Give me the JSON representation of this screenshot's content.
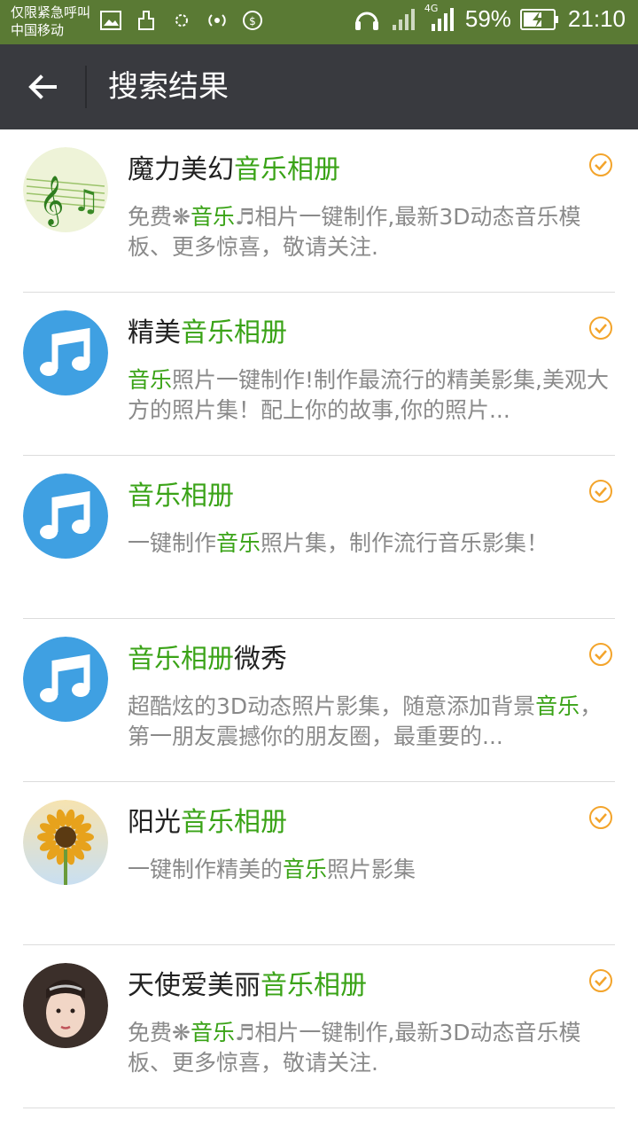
{
  "status_bar": {
    "carrier_line1": "仅限紧急呼叫",
    "carrier_line2": "中国移动",
    "network": "4G",
    "battery": "59%",
    "time": "21:10"
  },
  "toolbar": {
    "title": "搜索结果"
  },
  "results": [
    {
      "avatar": "music-staff-avatar",
      "name_parts": [
        {
          "t": "魔力美幻",
          "h": false
        },
        {
          "t": "音乐相册",
          "h": true
        }
      ],
      "desc_parts": [
        {
          "t": "免费❋",
          "h": false
        },
        {
          "t": "音乐",
          "h": true
        },
        {
          "t": "♬相片一键制作,最新3D动态音乐模板、更多惊喜，敬请关注.",
          "h": false
        }
      ]
    },
    {
      "avatar": "music-note-avatar",
      "name_parts": [
        {
          "t": "精美",
          "h": false
        },
        {
          "t": "音乐相册",
          "h": true
        }
      ],
      "desc_parts": [
        {
          "t": "音乐",
          "h": true
        },
        {
          "t": "照片一键制作!制作最流行的精美影集,美观大方的照片集！配上你的故事,你的照片...",
          "h": false
        }
      ]
    },
    {
      "avatar": "music-note-avatar",
      "name_parts": [
        {
          "t": "音乐相册",
          "h": true
        }
      ],
      "desc_parts": [
        {
          "t": "一键制作",
          "h": false
        },
        {
          "t": "音乐",
          "h": true
        },
        {
          "t": "照片集，制作流行音乐影集！",
          "h": false
        }
      ]
    },
    {
      "avatar": "music-note-avatar",
      "name_parts": [
        {
          "t": "音乐相册",
          "h": true
        },
        {
          "t": "微秀",
          "h": false
        }
      ],
      "desc_parts": [
        {
          "t": "超酷炫的3D动态照片影集，随意添加背景",
          "h": false
        },
        {
          "t": "音乐",
          "h": true
        },
        {
          "t": "，第一朋友震撼你的朋友圈，最重要的...",
          "h": false
        }
      ]
    },
    {
      "avatar": "sunflower-avatar",
      "name_parts": [
        {
          "t": "阳光",
          "h": false
        },
        {
          "t": "音乐相册",
          "h": true
        }
      ],
      "desc_parts": [
        {
          "t": "一键制作精美的",
          "h": false
        },
        {
          "t": "音乐",
          "h": true
        },
        {
          "t": "照片影集",
          "h": false
        }
      ]
    },
    {
      "avatar": "portrait-avatar",
      "name_parts": [
        {
          "t": "天使爱美丽",
          "h": false
        },
        {
          "t": "音乐相册",
          "h": true
        }
      ],
      "desc_parts": [
        {
          "t": "免费❋",
          "h": false
        },
        {
          "t": "音乐",
          "h": true
        },
        {
          "t": "♬相片一键制作,最新3D动态音乐模板、更多惊喜，敬请关注.",
          "h": false
        }
      ]
    }
  ],
  "colors": {
    "highlight": "#3aa317",
    "verified": "#f3a42b",
    "toolbar": "#393a3f",
    "statusbar": "#5a7a34"
  }
}
